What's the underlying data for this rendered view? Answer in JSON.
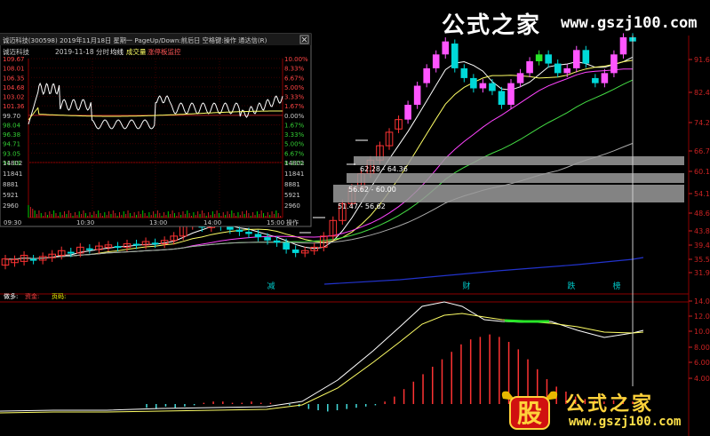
{
  "brand": {
    "top_zh": "公式之家",
    "top_url": "www.gszj100.com",
    "bottom_zh": "公式之家",
    "bottom_url": "www.gszj100.com",
    "logo_char": "股"
  },
  "intraday": {
    "title": "诚迈科技(300598) 2019年11月18日 星期一 PageUp/Down:前后日 空格键:操作 通达信(R)",
    "subtitle_name": "诚迈科技",
    "subtitle_date": "2019-11-18 分时",
    "legend": [
      "均线",
      "成交量",
      "涨停板监控"
    ],
    "price_labels": [
      "109.67",
      "108.01",
      "106.35",
      "104.68",
      "103.02",
      "101.36",
      "99.70",
      "98.04",
      "96.38",
      "94.71",
      "93.05",
      "91.39"
    ],
    "pct_labels": [
      "10.00%",
      "8.33%",
      "6.67%",
      "5.00%",
      "3.33%",
      "1.67%",
      "0.00%",
      "1.67%",
      "3.33%",
      "5.00%",
      "6.67%",
      "8.33%"
    ],
    "vol_labels": [
      "14802",
      "11841",
      "8881",
      "5921",
      "2960"
    ],
    "time_labels": [
      "09:30",
      "10:30",
      "13:00",
      "14:00",
      "15:00"
    ],
    "operate": "操作"
  },
  "main": {
    "right_axis": [
      "91.62",
      "82.46",
      "74.21",
      "66.79",
      "60.11",
      "54.10",
      "48.69",
      "43.82",
      "39.44",
      "35.50",
      "31.95"
    ],
    "boxes": [
      "62.28 - 64.36",
      "56.62 - 60.00",
      "51.47 - 56.62"
    ],
    "markers": [
      {
        "label": "减",
        "color": "#00c8c8"
      },
      {
        "label": "财",
        "color": "#00c8c8"
      },
      {
        "label": "跌",
        "color": "#00c8c8"
      },
      {
        "label": "榜",
        "color": "#00c8c8"
      }
    ]
  },
  "indicator": {
    "legend": [
      "做多:",
      "资金:",
      "页码:"
    ],
    "legend_colors": [
      "#ffffff",
      "#ff4444",
      "#ffff00"
    ],
    "right_axis": [
      "14.00",
      "12.00",
      "10.00",
      "8.00",
      "6.00",
      "4.00"
    ]
  },
  "chart_data": {
    "type": "candlestick",
    "candles": [
      {
        "o": 33.0,
        "c": 34.0
      },
      {
        "o": 33.4,
        "c": 33.9
      },
      {
        "o": 33.6,
        "c": 34.6
      },
      {
        "o": 34.0,
        "c": 33.8
      },
      {
        "o": 33.8,
        "c": 34.4
      },
      {
        "o": 34.2,
        "c": 34.8
      },
      {
        "o": 34.6,
        "c": 35.4
      },
      {
        "o": 35.2,
        "c": 35.0
      },
      {
        "o": 35.0,
        "c": 36.0
      },
      {
        "o": 35.8,
        "c": 35.6
      },
      {
        "o": 35.6,
        "c": 36.2
      },
      {
        "o": 36.0,
        "c": 36.4
      },
      {
        "o": 36.2,
        "c": 36.0
      },
      {
        "o": 36.0,
        "c": 36.6
      },
      {
        "o": 36.6,
        "c": 36.4
      },
      {
        "o": 36.4,
        "c": 37.0
      },
      {
        "o": 36.8,
        "c": 36.6
      },
      {
        "o": 36.6,
        "c": 37.2
      },
      {
        "o": 37.2,
        "c": 38.0
      },
      {
        "o": 38.0,
        "c": 40.0
      },
      {
        "o": 40.0,
        "c": 41.0
      },
      {
        "o": 41.0,
        "c": 39.6
      },
      {
        "o": 39.6,
        "c": 40.4
      },
      {
        "o": 40.4,
        "c": 39.8
      },
      {
        "o": 39.8,
        "c": 39.2
      },
      {
        "o": 39.2,
        "c": 38.8
      },
      {
        "o": 38.8,
        "c": 38.4
      },
      {
        "o": 38.4,
        "c": 37.8
      },
      {
        "o": 37.8,
        "c": 37.2
      },
      {
        "o": 37.2,
        "c": 36.8
      },
      {
        "o": 36.8,
        "c": 35.6
      },
      {
        "o": 35.6,
        "c": 35.0
      },
      {
        "o": 35.0,
        "c": 35.4
      },
      {
        "o": 35.4,
        "c": 36.0
      },
      {
        "o": 36.0,
        "c": 38.0
      },
      {
        "o": 38.0,
        "c": 41.0
      },
      {
        "o": 41.0,
        "c": 44.5
      },
      {
        "o": 44.5,
        "c": 48.0
      },
      {
        "o": 48.0,
        "c": 51.5
      },
      {
        "o": 51.5,
        "c": 55.0
      },
      {
        "o": 55.0,
        "c": 59.0
      },
      {
        "o": 59.0,
        "c": 63.0
      },
      {
        "o": 64.0,
        "c": 67.0
      },
      {
        "o": 67.0,
        "c": 72.0
      },
      {
        "o": 72.0,
        "c": 79.0
      },
      {
        "o": 80.0,
        "c": 86.0
      },
      {
        "o": 86.0,
        "c": 92.0
      },
      {
        "o": 92.0,
        "c": 98.0
      },
      {
        "o": 97.0,
        "c": 86.0
      },
      {
        "o": 86.0,
        "c": 82.0
      },
      {
        "o": 82.0,
        "c": 78.0
      },
      {
        "o": 78.0,
        "c": 80.0
      },
      {
        "o": 80.0,
        "c": 77.0
      },
      {
        "o": 77.0,
        "c": 72.0
      },
      {
        "o": 72.0,
        "c": 80.0
      },
      {
        "o": 80.0,
        "c": 84.0
      },
      {
        "o": 84.0,
        "c": 89.0
      },
      {
        "o": 89.0,
        "c": 92.0
      },
      {
        "o": 92.0,
        "c": 88.0
      },
      {
        "o": 88.0,
        "c": 84.0
      },
      {
        "o": 84.0,
        "c": 86.0
      },
      {
        "o": 86.0,
        "c": 94.0
      },
      {
        "o": 94.0,
        "c": 88.0
      },
      {
        "o": 82.0,
        "c": 80.0
      },
      {
        "o": 80.0,
        "c": 84.0
      },
      {
        "o": 84.0,
        "c": 92.0
      },
      {
        "o": 92.0,
        "c": 100.0
      },
      {
        "o": 100.0,
        "c": 98.0
      }
    ],
    "macd_bars": [
      -0.3,
      -0.4,
      -0.2,
      -0.3,
      -0.2,
      -0.1,
      0.1,
      0.2,
      0.2,
      0.1,
      0.1,
      0.2,
      0.1,
      0.1,
      0.0,
      -0.1,
      -0.2,
      -0.4,
      -0.5,
      -0.6,
      -0.5,
      -0.4,
      -0.3,
      -0.2,
      -0.1,
      0.2,
      0.6,
      1.2,
      1.8,
      2.4,
      3.0,
      3.6,
      4.2,
      4.8,
      5.2,
      5.4,
      5.6,
      5.4,
      5.0,
      4.4,
      3.6,
      2.8,
      2.0,
      1.4,
      1.0,
      0.6,
      0.4,
      0.3,
      0.2,
      0.3,
      0.4,
      0.2
    ],
    "ylim": [
      31.95,
      100
    ]
  }
}
